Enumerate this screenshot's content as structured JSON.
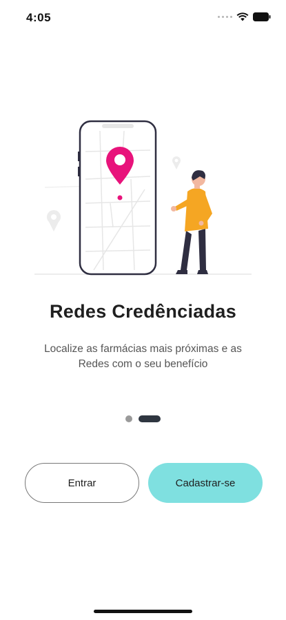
{
  "status_bar": {
    "time": "4:05",
    "icons": [
      "signal-icon",
      "wifi-icon",
      "battery-icon"
    ]
  },
  "illustration": {
    "description_icons": [
      "phone-map-illustration",
      "location-pin-icon",
      "person-illustration"
    ],
    "accent_color": "#e8137b"
  },
  "onboarding": {
    "title": "Redes Credênciadas",
    "subtitle": "Localize as farmácias mais próximas e as Redes com o seu benefício",
    "page_count": 2,
    "active_page": 2
  },
  "actions": {
    "login_label": "Entrar",
    "signup_label": "Cadastrar-se",
    "signup_color": "#7fe0e0"
  }
}
